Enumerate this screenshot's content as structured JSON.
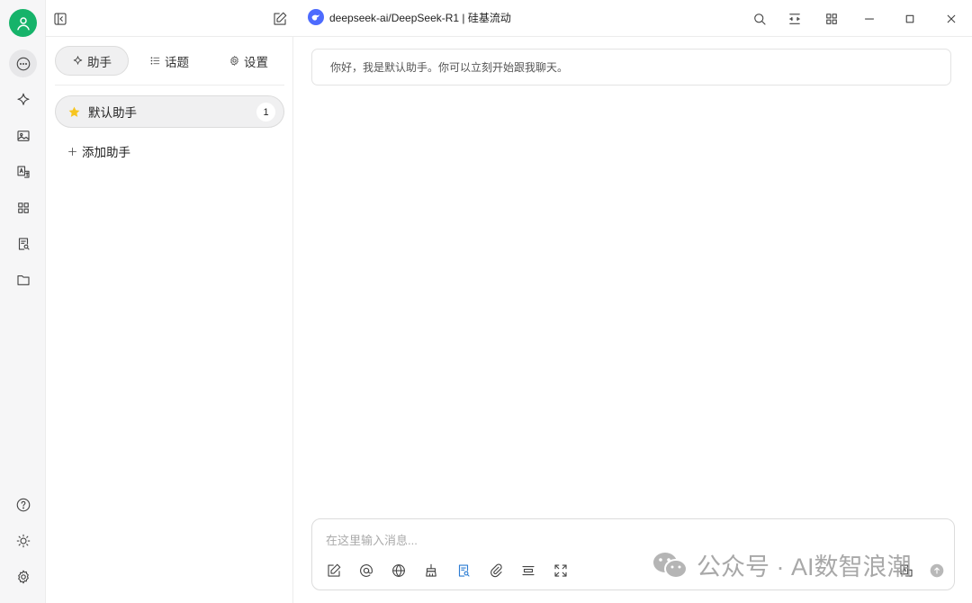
{
  "app": {
    "model_title": "deepseek-ai/DeepSeek-R1 | 硅基流动"
  },
  "sidebar": {
    "tabs": [
      {
        "label": "助手",
        "icon": "sparkle-icon"
      },
      {
        "label": "话题",
        "icon": "list-icon"
      },
      {
        "label": "设置",
        "icon": "gear-icon"
      }
    ],
    "assistant": {
      "name": "默认助手",
      "count": "1",
      "icon": "star-icon"
    },
    "add_label": "添加助手"
  },
  "chat": {
    "welcome": "你好，我是默认助手。你可以立刻开始跟我聊天。",
    "input_placeholder": "在这里输入消息..."
  },
  "watermark": {
    "text": "公众号 · AI数智浪潮"
  },
  "colors": {
    "avatar": "#16b36a",
    "accent_blue": "#2b7cd3",
    "star": "#f7c51f",
    "model_logo": "#4d6bfe"
  }
}
